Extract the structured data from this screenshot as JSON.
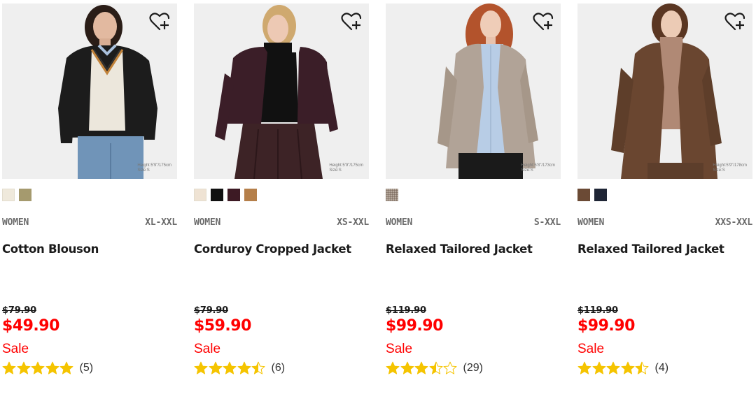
{
  "colors": {
    "sale_red": "#ff0000",
    "star_gold": "#f5c400",
    "text_dark": "#1b1b1b",
    "text_gray": "#6b6b6b"
  },
  "products": [
    {
      "gender": "WOMEN",
      "sizes": "XL-XXL",
      "name": "Cotton Blouson",
      "original_price": "$79.90",
      "price": "$49.90",
      "sale_label": "Sale",
      "rating": 5,
      "review_count": "(5)",
      "model_note": [
        "Height:5'9\"/175cm",
        "Size:S"
      ],
      "swatches": [
        "#efe9dc",
        "#a59a6e"
      ],
      "favorite_icon": "heart-plus-icon"
    },
    {
      "gender": "WOMEN",
      "sizes": "XS-XXL",
      "name": "Corduroy Cropped Jacket",
      "original_price": "$79.90",
      "price": "$59.90",
      "sale_label": "Sale",
      "rating": 4.5,
      "review_count": "(6)",
      "model_note": [
        "Height:5'9\"/175cm",
        "Size:S"
      ],
      "swatches": [
        "#efe3d4",
        "#111111",
        "#3d1a24",
        "#b57f4a"
      ],
      "favorite_icon": "heart-plus-icon"
    },
    {
      "gender": "WOMEN",
      "sizes": "S-XXL",
      "name": "Relaxed Tailored Jacket",
      "original_price": "$119.90",
      "price": "$99.90",
      "sale_label": "Sale",
      "rating": 3.5,
      "review_count": "(29)",
      "model_note": [
        "Height:5'8\"/173cm",
        "Size:S"
      ],
      "swatches": [
        "#b5a89c"
      ],
      "favorite_icon": "heart-plus-icon"
    },
    {
      "gender": "WOMEN",
      "sizes": "XXS-XXL",
      "name": "Relaxed Tailored Jacket",
      "original_price": "$119.90",
      "price": "$99.90",
      "sale_label": "Sale",
      "rating": 4.5,
      "review_count": "(4)",
      "model_note": [
        "Height:5'9\"/178cm",
        "Size:S"
      ],
      "swatches": [
        "#6b4a35",
        "#1f2535"
      ],
      "favorite_icon": "heart-plus-icon"
    }
  ]
}
